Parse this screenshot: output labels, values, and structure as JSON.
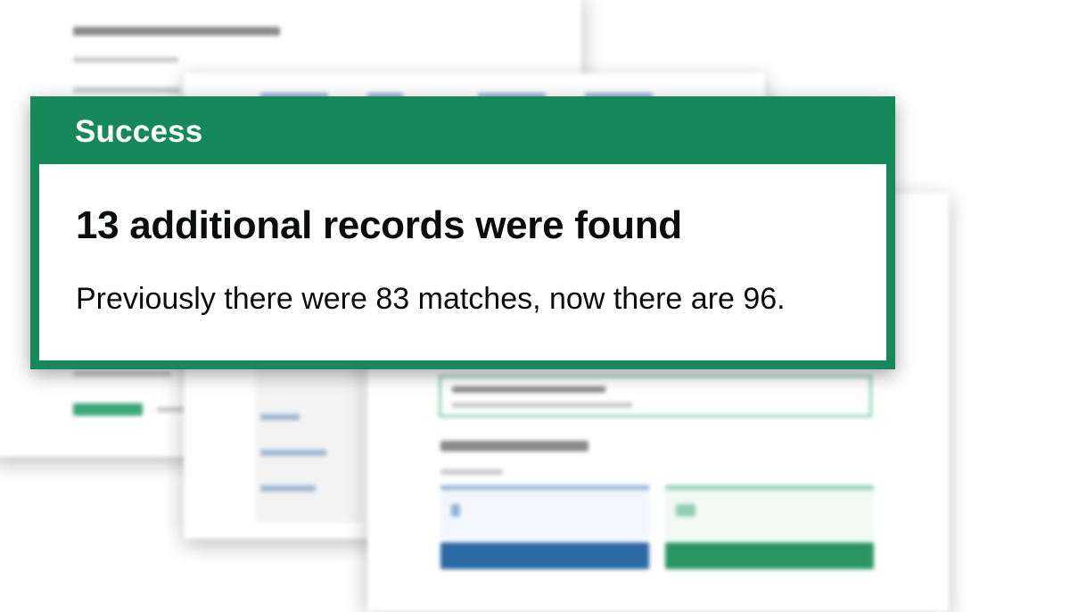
{
  "banner": {
    "title": "Success",
    "heading": "13 additional records were found",
    "body": "Previously there were 83 matches, now there are 96."
  },
  "colors": {
    "success_green": "#16895a",
    "text": "#0b0c0c",
    "link_blue": "#1d70b8"
  }
}
